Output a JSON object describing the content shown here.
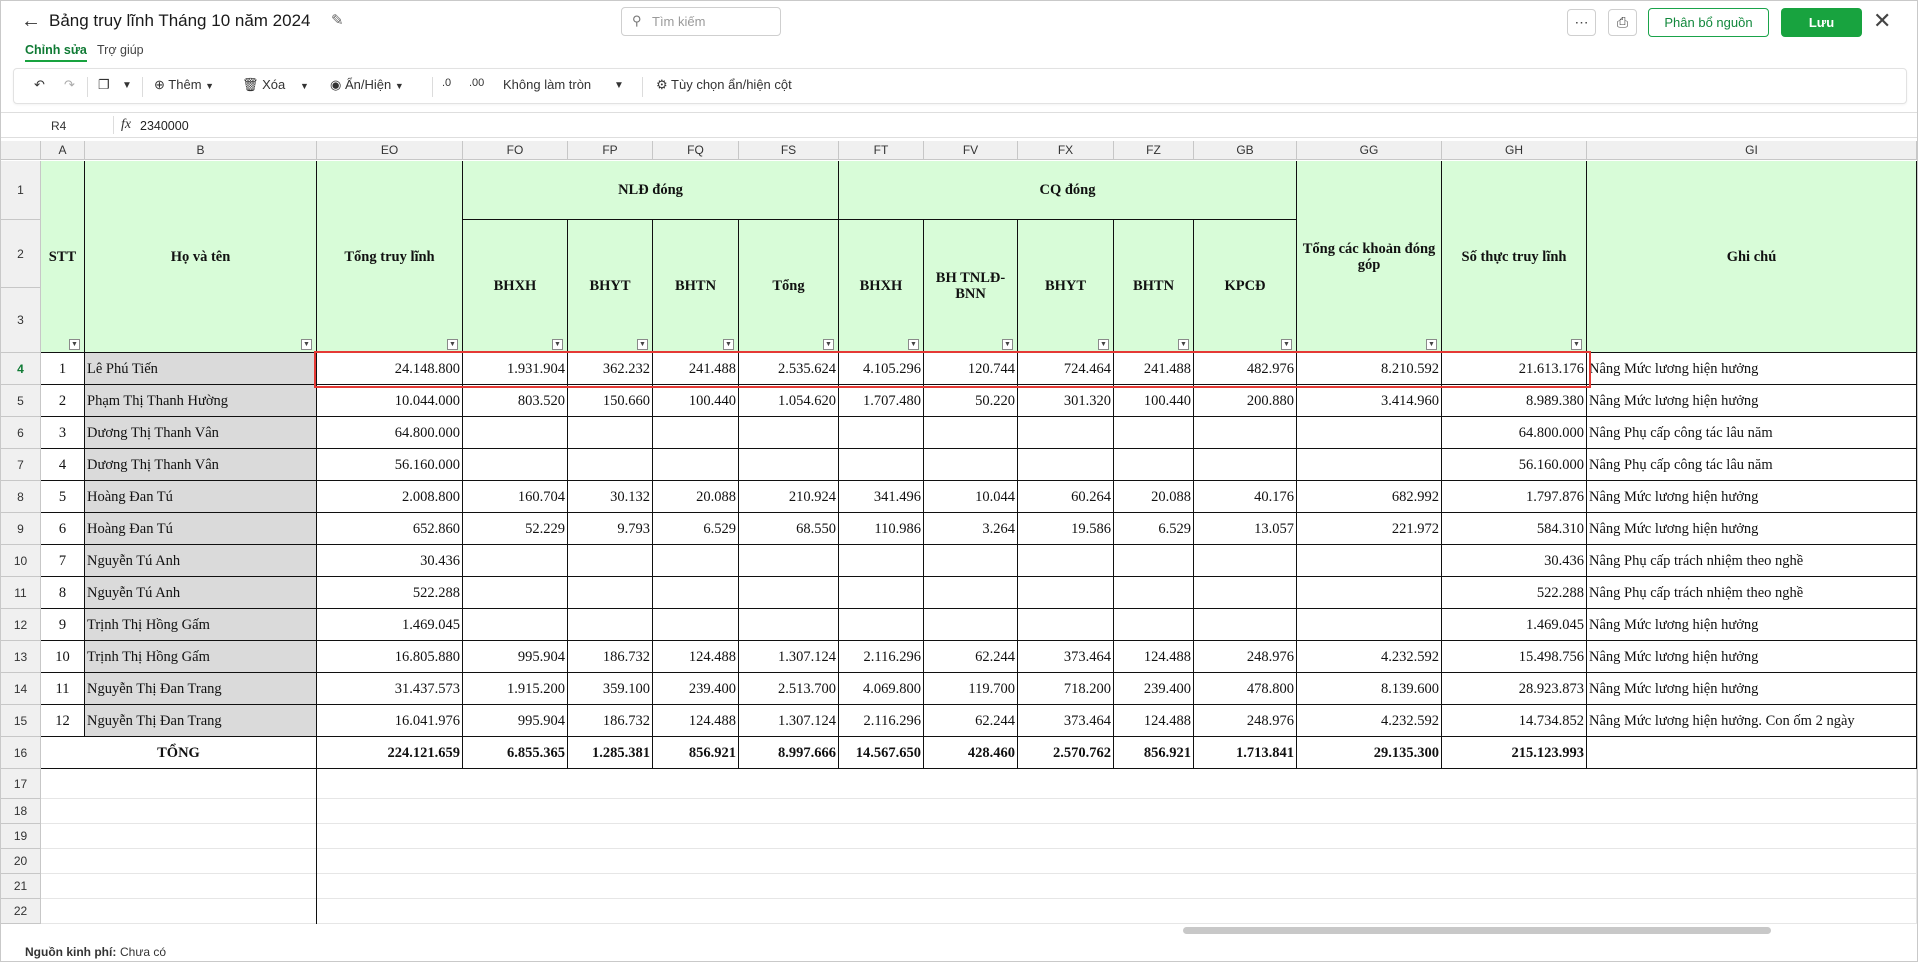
{
  "header": {
    "title": "Bảng truy lĩnh Tháng 10 năm 2024",
    "search_placeholder": "Tìm kiếm",
    "allocate_label": "Phân bổ nguồn",
    "save_label": "Lưu"
  },
  "tabs": [
    {
      "label": "Chỉnh sửa",
      "active": true
    },
    {
      "label": "Trợ giúp",
      "active": false
    }
  ],
  "toolbar": {
    "add_label": "Thêm",
    "delete_label": "Xóa",
    "showhide_label": "Ẩn/Hiện",
    "rounding_label": "Không làm tròn",
    "column_options_label": "Tùy chọn ẩn/hiện cột",
    "decimal_dec": ".0",
    "decimal_inc": ".00"
  },
  "formula": {
    "cell_ref": "R4",
    "fx_label": "fx",
    "value": "2340000"
  },
  "columns": [
    "A",
    "B",
    "EO",
    "FO",
    "FP",
    "FQ",
    "FS",
    "FT",
    "FV",
    "FX",
    "FZ",
    "GB",
    "GG",
    "GH",
    "GI"
  ],
  "headers": {
    "stt": "STT",
    "name": "Họ và tên",
    "total_arrears": "Tổng truy lĩnh",
    "employee_group": "NLĐ đóng",
    "agency_group": "CQ đóng",
    "bhxh": "BHXH",
    "bhyt": "BHYT",
    "bhtn": "BHTN",
    "tong": "Tổng",
    "bhtnld": "BH TNLĐ-BNN",
    "kpcd": "KPCĐ",
    "total_contrib": "Tổng các khoản đóng góp",
    "net": "Số thực truy lĩnh",
    "note": "Ghi chú"
  },
  "rows": [
    {
      "stt": "1",
      "name": "Lê Phú Tiến",
      "total": "24.148.800",
      "fo": "1.931.904",
      "fp": "362.232",
      "fq": "241.488",
      "fs": "2.535.624",
      "ft": "4.105.296",
      "fv": "120.744",
      "fx": "724.464",
      "fz": "241.488",
      "gb": "482.976",
      "gg": "8.210.592",
      "gh": "21.613.176",
      "note": "Nâng Mức lương hiện hưởng"
    },
    {
      "stt": "2",
      "name": "Phạm Thị Thanh  Hường",
      "total": "10.044.000",
      "fo": "803.520",
      "fp": "150.660",
      "fq": "100.440",
      "fs": "1.054.620",
      "ft": "1.707.480",
      "fv": "50.220",
      "fx": "301.320",
      "fz": "100.440",
      "gb": "200.880",
      "gg": "3.414.960",
      "gh": "8.989.380",
      "note": "Nâng Mức lương hiện hưởng"
    },
    {
      "stt": "3",
      "name": "Dương Thị Thanh Vân",
      "total": "64.800.000",
      "fo": "",
      "fp": "",
      "fq": "",
      "fs": "",
      "ft": "",
      "fv": "",
      "fx": "",
      "fz": "",
      "gb": "",
      "gg": "",
      "gh": "64.800.000",
      "note": "Nâng Phụ cấp công tác lâu năm"
    },
    {
      "stt": "4",
      "name": "Dương Thị Thanh Vân",
      "total": "56.160.000",
      "fo": "",
      "fp": "",
      "fq": "",
      "fs": "",
      "ft": "",
      "fv": "",
      "fx": "",
      "fz": "",
      "gb": "",
      "gg": "",
      "gh": "56.160.000",
      "note": "Nâng Phụ cấp công tác lâu năm"
    },
    {
      "stt": "5",
      "name": "Hoàng Đan Tú",
      "total": "2.008.800",
      "fo": "160.704",
      "fp": "30.132",
      "fq": "20.088",
      "fs": "210.924",
      "ft": "341.496",
      "fv": "10.044",
      "fx": "60.264",
      "fz": "20.088",
      "gb": "40.176",
      "gg": "682.992",
      "gh": "1.797.876",
      "note": "Nâng Mức lương hiện hưởng"
    },
    {
      "stt": "6",
      "name": "Hoàng Đan Tú",
      "total": "652.860",
      "fo": "52.229",
      "fp": "9.793",
      "fq": "6.529",
      "fs": "68.550",
      "ft": "110.986",
      "fv": "3.264",
      "fx": "19.586",
      "fz": "6.529",
      "gb": "13.057",
      "gg": "221.972",
      "gh": "584.310",
      "note": "Nâng Mức lương hiện hưởng"
    },
    {
      "stt": "7",
      "name": "Nguyễn Tú Anh",
      "total": "30.436",
      "fo": "",
      "fp": "",
      "fq": "",
      "fs": "",
      "ft": "",
      "fv": "",
      "fx": "",
      "fz": "",
      "gb": "",
      "gg": "",
      "gh": "30.436",
      "note": "Nâng Phụ cấp trách nhiệm theo nghề"
    },
    {
      "stt": "8",
      "name": "Nguyễn Tú Anh",
      "total": "522.288",
      "fo": "",
      "fp": "",
      "fq": "",
      "fs": "",
      "ft": "",
      "fv": "",
      "fx": "",
      "fz": "",
      "gb": "",
      "gg": "",
      "gh": "522.288",
      "note": "Nâng Phụ cấp trách nhiệm theo nghề"
    },
    {
      "stt": "9",
      "name": "Trịnh Thị Hồng Gấm",
      "total": "1.469.045",
      "fo": "",
      "fp": "",
      "fq": "",
      "fs": "",
      "ft": "",
      "fv": "",
      "fx": "",
      "fz": "",
      "gb": "",
      "gg": "",
      "gh": "1.469.045",
      "note": "Nâng Mức lương hiện hưởng"
    },
    {
      "stt": "10",
      "name": "Trịnh Thị Hồng Gấm",
      "total": "16.805.880",
      "fo": "995.904",
      "fp": "186.732",
      "fq": "124.488",
      "fs": "1.307.124",
      "ft": "2.116.296",
      "fv": "62.244",
      "fx": "373.464",
      "fz": "124.488",
      "gb": "248.976",
      "gg": "4.232.592",
      "gh": "15.498.756",
      "note": "Nâng Mức lương hiện hưởng"
    },
    {
      "stt": "11",
      "name": "Nguyễn Thị  Đan Trang",
      "total": "31.437.573",
      "fo": "1.915.200",
      "fp": "359.100",
      "fq": "239.400",
      "fs": "2.513.700",
      "ft": "4.069.800",
      "fv": "119.700",
      "fx": "718.200",
      "fz": "239.400",
      "gb": "478.800",
      "gg": "8.139.600",
      "gh": "28.923.873",
      "note": "Nâng Mức lương hiện hưởng"
    },
    {
      "stt": "12",
      "name": "Nguyễn Thị  Đan Trang",
      "total": "16.041.976",
      "fo": "995.904",
      "fp": "186.732",
      "fq": "124.488",
      "fs": "1.307.124",
      "ft": "2.116.296",
      "fv": "62.244",
      "fx": "373.464",
      "fz": "124.488",
      "gb": "248.976",
      "gg": "4.232.592",
      "gh": "14.734.852",
      "note": "Nâng Mức lương hiện hưởng. Con ốm 2 ngày"
    }
  ],
  "total_row": {
    "label": "TỔNG",
    "total": "224.121.659",
    "fo": "6.855.365",
    "fp": "1.285.381",
    "fq": "856.921",
    "fs": "8.997.666",
    "ft": "14.567.650",
    "fv": "428.460",
    "fx": "2.570.762",
    "fz": "856.921",
    "gb": "1.713.841",
    "gg": "29.135.300",
    "gh": "215.123.993"
  },
  "row_numbers": [
    "1",
    "2",
    "3",
    "4",
    "5",
    "6",
    "7",
    "8",
    "9",
    "10",
    "11",
    "12",
    "13",
    "14",
    "15",
    "16",
    "17",
    "18",
    "19",
    "20",
    "21",
    "22"
  ],
  "footer": {
    "label": "Nguồn kinh phí",
    "value": "Chưa có"
  },
  "colors": {
    "accent": "#18a33f",
    "header_fill": "#d8fcd8",
    "selection": "#e53935"
  }
}
